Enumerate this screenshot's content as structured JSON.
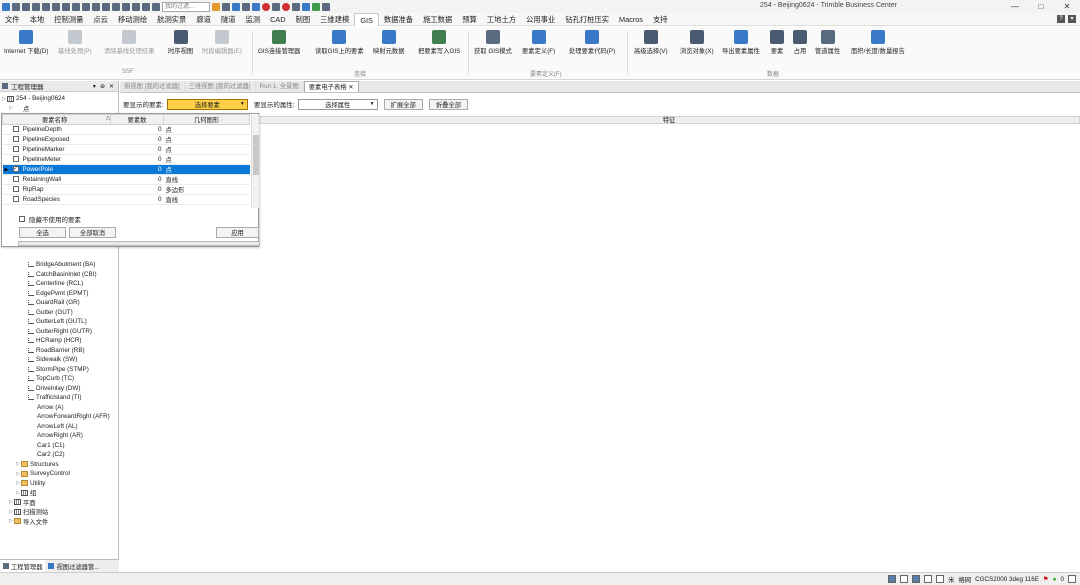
{
  "title_bar": {
    "title": "254 - Beijing0624 - Trimble Business Center",
    "search_placeholder": "我的过滤..."
  },
  "menu": {
    "items": [
      "文件",
      "本地",
      "控制测量",
      "点云",
      "移动测绘",
      "航测实景",
      "廊道",
      "隧道",
      "监测",
      "CAD",
      "制图",
      "三维建模",
      "GIS",
      "数据准备",
      "施工数据",
      "预算",
      "工地土方",
      "公用事业",
      "钻孔打桩压实",
      "Macros",
      "支持"
    ],
    "active": "GIS"
  },
  "ribbon": {
    "buttons": [
      {
        "label": "Internet 下载(D)",
        "disabled": false
      },
      {
        "label": "基线处理(P)",
        "disabled": true
      },
      {
        "label": "清除基线处理结果",
        "disabled": true
      },
      {
        "label": "时序视图",
        "disabled": false
      },
      {
        "label": "时段编辑器(E)",
        "disabled": true
      },
      {
        "label": "GIS连接管理器",
        "disabled": false
      },
      {
        "label": "读取GIS上的要素",
        "disabled": false
      },
      {
        "label": "映射元数据",
        "disabled": false
      },
      {
        "label": "把要素写入GIS",
        "disabled": false
      },
      {
        "label": "获取 GIS模式",
        "disabled": false
      },
      {
        "label": "要素定义(F)",
        "disabled": false
      },
      {
        "label": "处理要素代码(P)",
        "disabled": false
      },
      {
        "label": "高级选择(V)",
        "disabled": false
      },
      {
        "label": "浏览对象(X)",
        "disabled": false
      },
      {
        "label": "导出要素属性",
        "disabled": false
      },
      {
        "label": "要素",
        "disabled": false
      },
      {
        "label": "占用",
        "disabled": false
      },
      {
        "label": "管道属性",
        "disabled": false
      },
      {
        "label": "面积/长度/数量报告",
        "disabled": false
      }
    ],
    "groups": [
      "SSF",
      "连接",
      "要素定义(F)",
      "数据"
    ]
  },
  "left_panel": {
    "title": "工程管理器",
    "tree": [
      {
        "label": "254 - Beijing0624",
        "icon": "project",
        "indent": 0
      },
      {
        "label": "点",
        "icon": "point",
        "indent": 1
      },
      {
        "label": "BridgeAbutment (BA)",
        "icon": "line",
        "indent": 3
      },
      {
        "label": "CatchBasinInlet (CBI)",
        "icon": "line",
        "indent": 3
      },
      {
        "label": "Centerline (RCL)",
        "icon": "line",
        "indent": 3
      },
      {
        "label": "EdgePvmt (EPMT)",
        "icon": "line",
        "indent": 3
      },
      {
        "label": "GuardRail (GR)",
        "icon": "line",
        "indent": 3
      },
      {
        "label": "Gutter (GUT)",
        "icon": "line",
        "indent": 3
      },
      {
        "label": "GutterLeft (GUTL)",
        "icon": "line",
        "indent": 3
      },
      {
        "label": "GutterRight (GUTR)",
        "icon": "line",
        "indent": 3
      },
      {
        "label": "HCRamp (HCR)",
        "icon": "line",
        "indent": 3
      },
      {
        "label": "RoadBarrier (RB)",
        "icon": "line",
        "indent": 3
      },
      {
        "label": "Sidewalk (SW)",
        "icon": "line",
        "indent": 3
      },
      {
        "label": "StormPipe (STMP)",
        "icon": "line",
        "indent": 3
      },
      {
        "label": "TopCurb (TC)",
        "icon": "line",
        "indent": 3
      },
      {
        "label": "DriveInlay (DW)",
        "icon": "line",
        "indent": 3
      },
      {
        "label": "TrafficIsland (TI)",
        "icon": "line",
        "indent": 3
      },
      {
        "label": "Arrow (A)",
        "icon": "point",
        "indent": 3
      },
      {
        "label": "ArrowForwardRight (AFR)",
        "icon": "point",
        "indent": 3
      },
      {
        "label": "ArrowLeft (AL)",
        "icon": "point",
        "indent": 3
      },
      {
        "label": "ArrowRight (AR)",
        "icon": "point",
        "indent": 3
      },
      {
        "label": "Car1 (C1)",
        "icon": "point",
        "indent": 3
      },
      {
        "label": "Car2 (C2)",
        "icon": "point",
        "indent": 3
      },
      {
        "label": "Structures",
        "icon": "folder",
        "indent": 2
      },
      {
        "label": "SurveyControl",
        "icon": "folder",
        "indent": 2
      },
      {
        "label": "Utility",
        "icon": "folder",
        "indent": 2
      },
      {
        "label": "组",
        "icon": "grid",
        "indent": 2
      },
      {
        "label": "平面",
        "icon": "grid",
        "indent": 1
      },
      {
        "label": "扫描测站",
        "icon": "grid",
        "indent": 1
      },
      {
        "label": "导入文件",
        "icon": "folder",
        "indent": 1
      }
    ],
    "tabs": [
      "工程管理器",
      "视图过滤器管..."
    ]
  },
  "doc_tabs": {
    "items": [
      "俯视图 [我的过滤器]",
      "三维视图 [我的过滤器]",
      "Run 1, 全景图",
      "要素电子表格"
    ],
    "active": "要素电子表格"
  },
  "filter_bar": {
    "feature_label": "要显示的要素:",
    "feature_select": "选择要素",
    "attr_label": "要显示的属性:",
    "attr_select": "选择属性",
    "expand_all": "扩展全部",
    "collapse_all": "折叠全部",
    "column_header": "特征"
  },
  "popup": {
    "headers": [
      "要素名称",
      "要素数",
      "几何图形"
    ],
    "rows": [
      {
        "name": "PipelineDepth",
        "count": "0",
        "geom": "点",
        "checked": false,
        "selected": false
      },
      {
        "name": "PipelineExposed",
        "count": "0",
        "geom": "点",
        "checked": false,
        "selected": false
      },
      {
        "name": "PipelineMarker",
        "count": "0",
        "geom": "点",
        "checked": false,
        "selected": false
      },
      {
        "name": "PipelineMeter",
        "count": "0",
        "geom": "点",
        "checked": false,
        "selected": false
      },
      {
        "name": "PowerPole",
        "count": "0",
        "geom": "点",
        "checked": true,
        "selected": true
      },
      {
        "name": "RetainingWall",
        "count": "0",
        "geom": "直线",
        "checked": false,
        "selected": false
      },
      {
        "name": "RipRap",
        "count": "0",
        "geom": "多边形",
        "checked": false,
        "selected": false
      },
      {
        "name": "RoadSpecies",
        "count": "0",
        "geom": "直线",
        "checked": false,
        "selected": false
      }
    ],
    "hide_unused": "隐藏不使用的要素",
    "select_all": "全选",
    "deselect_all": "全部取消",
    "apply": "应用"
  },
  "status_bar": {
    "items": [
      "米",
      "格网",
      "CGCS2000 3deg 116E",
      "0"
    ]
  }
}
